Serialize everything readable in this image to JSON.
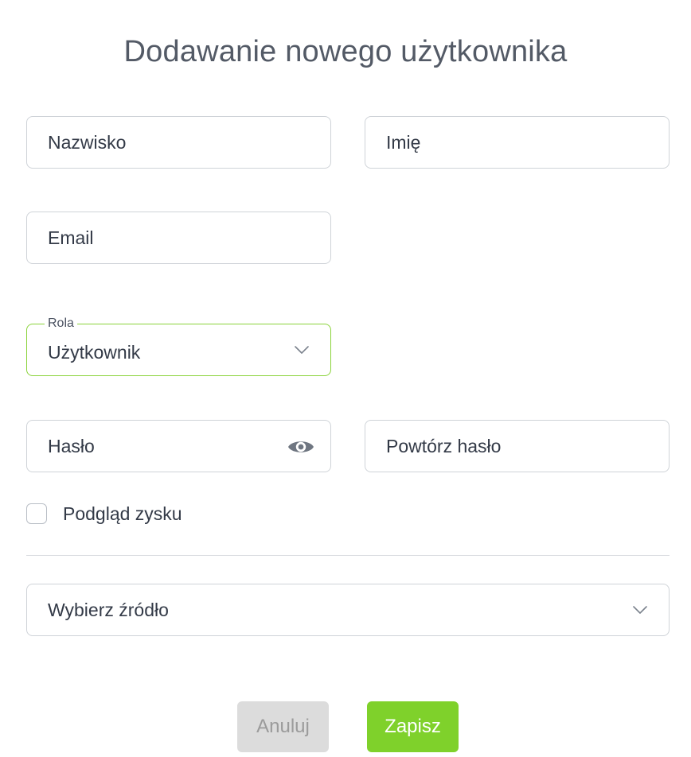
{
  "title": "Dodawanie nowego użytkownika",
  "fields": {
    "last_name": {
      "placeholder": "Nazwisko",
      "value": ""
    },
    "first_name": {
      "placeholder": "Imię",
      "value": ""
    },
    "email": {
      "placeholder": "Email",
      "value": ""
    },
    "role": {
      "label": "Rola",
      "value": "Użytkownik",
      "icon": "chevron-down-icon"
    },
    "password": {
      "placeholder": "Hasło",
      "value": "",
      "icon": "eye-icon"
    },
    "repeat_password": {
      "placeholder": "Powtórz hasło",
      "value": ""
    },
    "source": {
      "placeholder": "Wybierz źródło",
      "icon": "chevron-down-icon"
    }
  },
  "profit_preview": {
    "label": "Podgląd zysku",
    "checked": false
  },
  "buttons": {
    "cancel": "Anuluj",
    "save": "Zapisz"
  },
  "colors": {
    "accent": "#7fd12b",
    "active_border": "#8ad33a",
    "border": "#cfd3d8",
    "text": "#333a47",
    "title": "#535a66",
    "cancel_bg": "#dcdcdc",
    "cancel_text": "#9b9b9b"
  }
}
